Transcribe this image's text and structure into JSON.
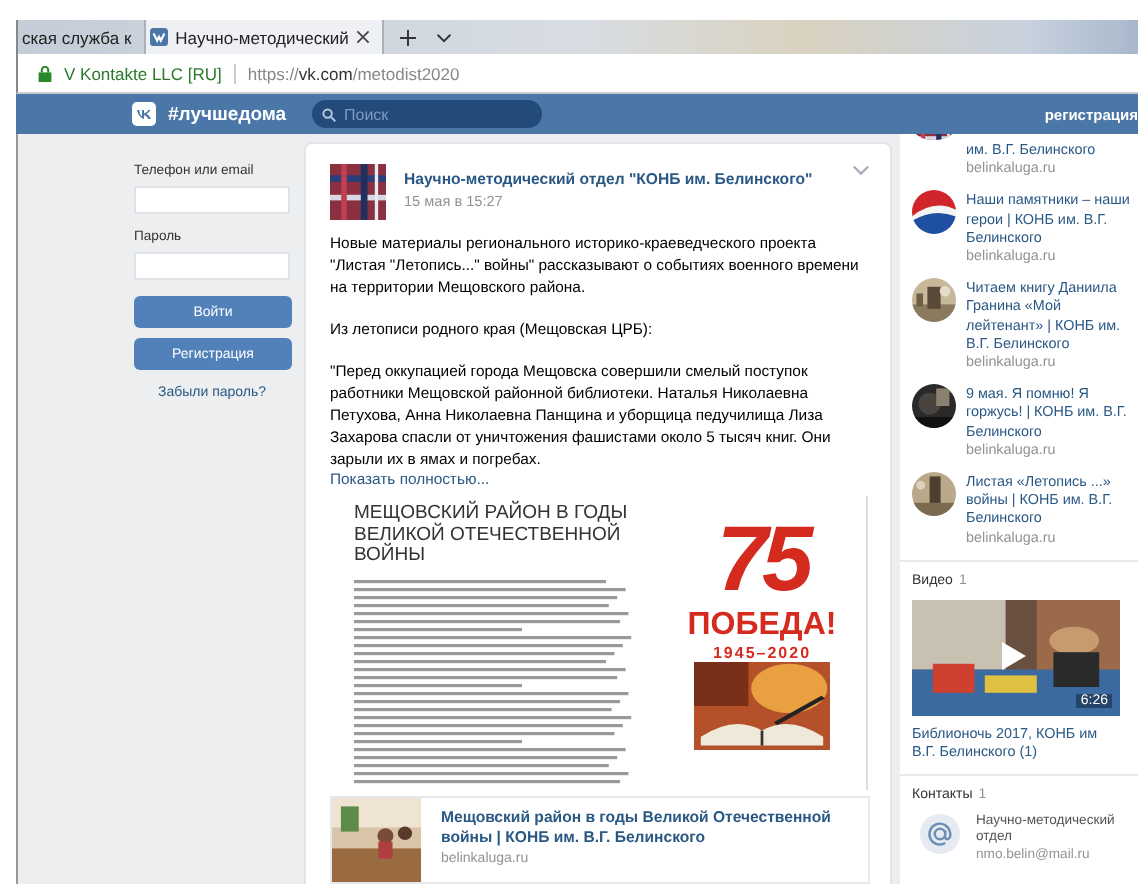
{
  "browser": {
    "tabs": [
      {
        "label": "ская служба к",
        "selected": false
      },
      {
        "label": "Научно-методический",
        "selected": true
      }
    ],
    "address_bar": {
      "identity": "V Kontakte LLC [RU]",
      "scheme": "https://",
      "host": "vk.com",
      "path": "/metodist2020"
    }
  },
  "header": {
    "hashtag": "#лучшедома",
    "search": {
      "placeholder": "Поиск"
    },
    "register_link": "регистрация"
  },
  "login": {
    "phone_label": "Телефон или email",
    "password_label": "Пароль",
    "login_button": "Войти",
    "register_button": "Регистрация",
    "forgot_link": "Забыли пароль?"
  },
  "post": {
    "author": "Научно-методический отдел \"КОНБ им. Белинского\"",
    "date": "15 мая в 15:27",
    "paragraphs": [
      "Новые материалы регионального историко-краеведческого проекта \"Листая \"Летопись...\" войны\" рассказывают о событиях военного времени на территории Мещовского района.",
      "Из летописи родного края (Мещовская ЦРБ):",
      "\"Перед оккупацией города Мещовска совершили смелый поступок работники Мещовской районной библиотеки. Наталья Николаевна Петухова, Анна Николаевна Панщина и уборщица педучилища Лиза Захарова спасли от уничтожения фашистами около 5 тысяч книг. Они зарыли их в ямах и погребах."
    ],
    "show_more": "Показать полностью...",
    "poster": {
      "title": "МЕЩОВСКИЙ РАЙОН В ГОДЫ ВЕЛИКОЙ ОТЕЧЕСТВЕННОЙ ВОЙНЫ",
      "number": "75",
      "slogan": "ПОБЕДА!",
      "years": "1945–2020"
    },
    "link": {
      "title": "Мещовский район в годы Великой Отечественной войны | КОНБ им. В.Г. Белинского",
      "domain": "belinkaluga.ru"
    }
  },
  "sidebar": {
    "links": [
      {
        "title": "им. В.Г. Белинского",
        "domain": "belinkaluga.ru"
      },
      {
        "title": "Наши памятники – наши герои | КОНБ им. В.Г. Белинского",
        "domain": "belinkaluga.ru"
      },
      {
        "title": "Читаем книгу Даниила Гранина «Мой лейтенант» | КОНБ им. В.Г. Белинского",
        "domain": "belinkaluga.ru"
      },
      {
        "title": "9 мая. Я помню! Я горжусь! | КОНБ им. В.Г. Белинского",
        "domain": "belinkaluga.ru"
      },
      {
        "title": "Листая «Летопись ...» войны | КОНБ им. В.Г. Белинского",
        "domain": "belinkaluga.ru"
      }
    ],
    "videos": {
      "heading": "Видео",
      "count": "1",
      "items": [
        {
          "duration": "6:26",
          "title": "Библионочь 2017, КОНБ им В.Г. Белинского (1)"
        }
      ]
    },
    "contacts": {
      "heading": "Контакты",
      "count": "1",
      "items": [
        {
          "name": "Научно-методический отдел",
          "email": "nmo.belin@mail.ru"
        }
      ]
    }
  }
}
